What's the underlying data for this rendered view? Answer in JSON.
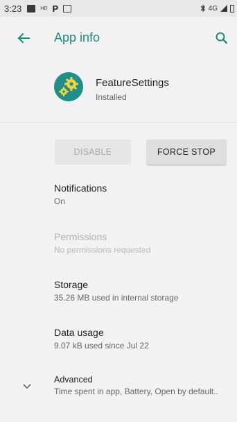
{
  "status_bar": {
    "time": "3:23",
    "network": "4G"
  },
  "toolbar": {
    "title": "App info"
  },
  "app": {
    "name": "FeatureSettings",
    "status": "Installed"
  },
  "buttons": {
    "disable": "DISABLE",
    "force_stop": "FORCE STOP"
  },
  "prefs": {
    "notifications": {
      "title": "Notifications",
      "summary": "On"
    },
    "permissions": {
      "title": "Permissions",
      "summary": "No permissions requested"
    },
    "storage": {
      "title": "Storage",
      "summary": "35.26 MB used in internal storage"
    },
    "data_usage": {
      "title": "Data usage",
      "summary": "9.07 kB used since Jul 22"
    },
    "advanced": {
      "title": "Advanced",
      "summary": "Time spent in app, Battery, Open by default.."
    }
  },
  "colors": {
    "accent": "#1a8c7c",
    "background": "#f2f2f2"
  }
}
